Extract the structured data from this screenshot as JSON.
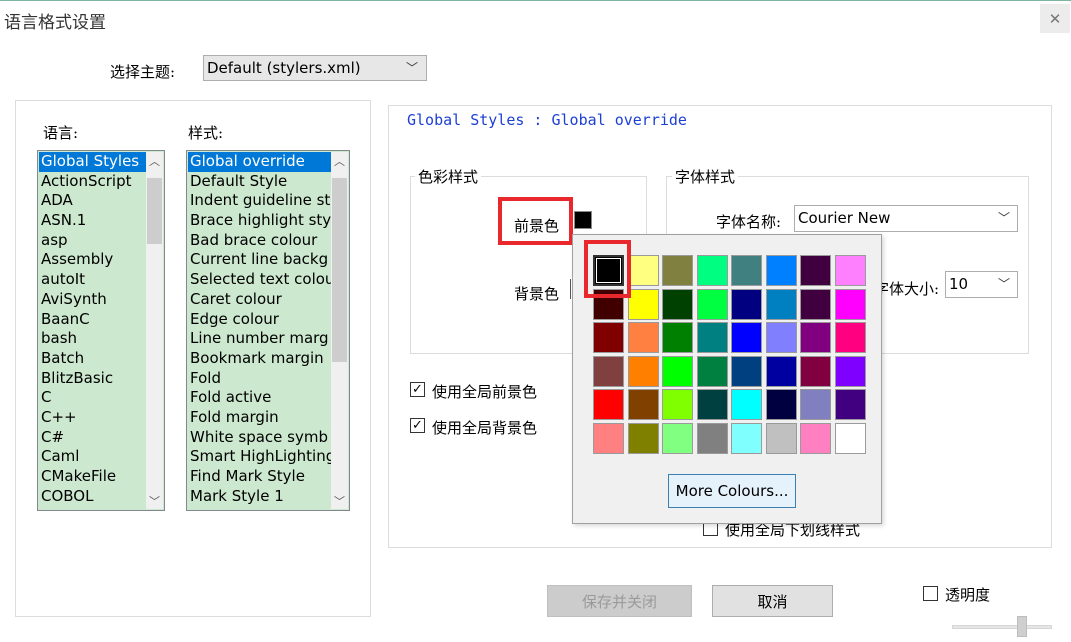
{
  "window": {
    "title": "语言格式设置",
    "close": "✕"
  },
  "theme": {
    "label": "选择主题:",
    "value": "Default (stylers.xml)"
  },
  "languages": {
    "label": "语言:",
    "items": [
      "Global Styles",
      "ActionScript",
      "ADA",
      "ASN.1",
      "asp",
      "Assembly",
      "autoIt",
      "AviSynth",
      "BaanC",
      "bash",
      "Batch",
      "BlitzBasic",
      "C",
      "C++",
      "C#",
      "Caml",
      "CMakeFile",
      "COBOL"
    ]
  },
  "styles": {
    "label": "样式:",
    "items": [
      "Global override",
      "Default Style",
      "Indent guideline st",
      "Brace highlight sty",
      "Bad brace colour",
      "Current line backg",
      "Selected text colou",
      "Caret colour",
      "Edge colour",
      "Line number marg",
      "Bookmark margin",
      "Fold",
      "Fold active",
      "Fold margin",
      "White space symb",
      "Smart HighLighting",
      "Find Mark Style",
      "Mark Style 1"
    ]
  },
  "style_header": "Global Styles : Global override",
  "color_group": {
    "legend": "色彩样式",
    "fg_label": "前景色",
    "bg_label": "背景色",
    "fg_color": "#000000"
  },
  "font_group": {
    "legend": "字体样式",
    "name_label": "字体名称:",
    "name_value": "Courier New",
    "size_label": "字体大小:",
    "size_value": "10"
  },
  "checkboxes": {
    "global_fg": "使用全局前景色",
    "global_bg": "使用全局背景色",
    "global_underline": "使用全局下划线样式",
    "transparency": "透明度"
  },
  "buttons": {
    "save_close": "保存并关闭",
    "cancel": "取消"
  },
  "color_popup": {
    "more_button": "More Colours...",
    "selected_color": "#000000",
    "colors": [
      "#000000",
      "#ffff80",
      "#808040",
      "#00ff80",
      "#408080",
      "#0080ff",
      "#400040",
      "#ff80ff",
      "#400000",
      "#ffff00",
      "#004000",
      "#00ff40",
      "#000080",
      "#0080c0",
      "#400040",
      "#ff00ff",
      "#800000",
      "#ff8040",
      "#008000",
      "#008080",
      "#0000ff",
      "#8080ff",
      "#800080",
      "#ff0080",
      "#804040",
      "#ff8000",
      "#00ff00",
      "#008040",
      "#004080",
      "#0000a0",
      "#800040",
      "#8000ff",
      "#ff0000",
      "#804000",
      "#80ff00",
      "#004040",
      "#00ffff",
      "#000040",
      "#8080c0",
      "#400080",
      "#ff8080",
      "#808000",
      "#80ff80",
      "#808080",
      "#80ffff",
      "#c0c0c0",
      "#ff80c0",
      "#ffffff"
    ]
  }
}
